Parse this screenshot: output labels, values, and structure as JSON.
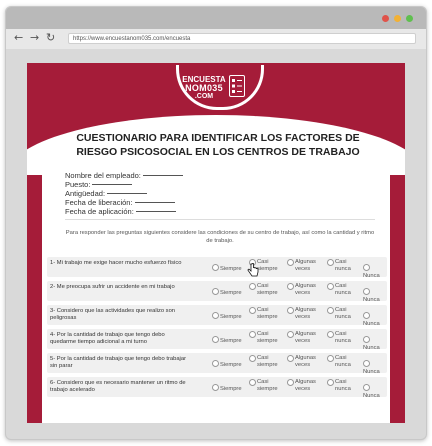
{
  "browser": {
    "url": "https://www.encuestanom035.com/encuesta",
    "nav_back": "←",
    "nav_forward": "→",
    "nav_reload": "↻",
    "window_dots": [
      "#e0534a",
      "#f2b134",
      "#5fbf4f"
    ]
  },
  "logo": {
    "line1": "ENCUESTA",
    "line2": "NOM035",
    "line3": ".COM"
  },
  "form": {
    "title": "CUESTIONARIO PARA IDENTIFICAR LOS FACTORES DE RIESGO PSICOSOCIAL EN LOS CENTROS DE TRABAJO",
    "fields": [
      {
        "label": "Nombre del empleado:"
      },
      {
        "label": "Puesto:"
      },
      {
        "label": "Antigüedad:"
      },
      {
        "label": "Fecha de liberación:"
      },
      {
        "label": "Fecha de aplicación:"
      }
    ],
    "instructions": "Para responder las preguntas siguientes considere las condiciones de su centro de trabajo, así como la cantidad y ritmo de trabajo.",
    "options": [
      "Siempre",
      "Casi siempre",
      "Algunas veces",
      "Casi nunca",
      "Nunca"
    ],
    "questions": [
      {
        "text": "1- Mi trabajo me exige hacer mucho esfuerzo físico"
      },
      {
        "text": "2- Me preocupa sufrir un accidente en mi trabajo"
      },
      {
        "text": "3- Considero que las actividades que realizo son peligrosas"
      },
      {
        "text": "4- Por la cantidad de trabajo que tengo debo quedarme tiempo adicional a mi turno"
      },
      {
        "text": "5- Por la cantidad de trabajo que tengo debo trabajar sin parar"
      },
      {
        "text": "6- Considero que es necesario mantener un ritmo de trabajo acelerado"
      }
    ]
  },
  "colors": {
    "brand": "#a51c39",
    "row_bg": "#f0f0f0"
  }
}
